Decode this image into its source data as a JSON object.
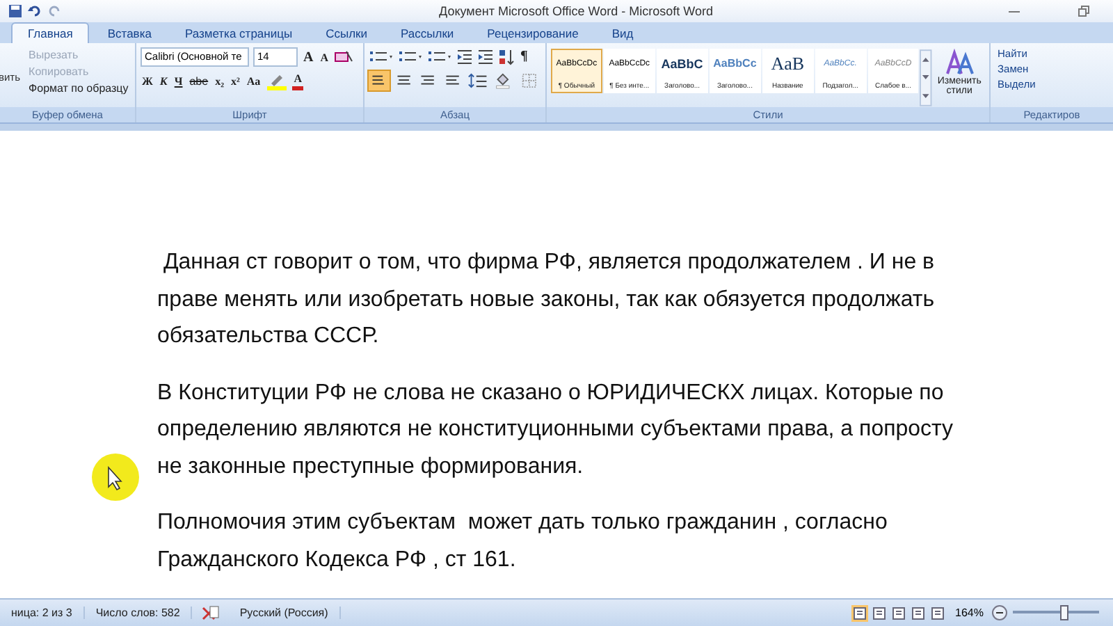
{
  "title_bar": {
    "title": "Документ Microsoft Office Word - Microsoft Word"
  },
  "tabs": [
    {
      "label": "Главная",
      "selected": true
    },
    {
      "label": "Вставка",
      "selected": false
    },
    {
      "label": "Разметка страницы",
      "selected": false
    },
    {
      "label": "Ссылки",
      "selected": false
    },
    {
      "label": "Рассылки",
      "selected": false
    },
    {
      "label": "Рецензирование",
      "selected": false
    },
    {
      "label": "Вид",
      "selected": false
    }
  ],
  "clipboard": {
    "paste_label": "вить",
    "items": [
      {
        "label": "Вырезать",
        "disabled": true
      },
      {
        "label": "Копировать",
        "disabled": true
      },
      {
        "label": "Формат по образцу",
        "disabled": false
      }
    ],
    "group_label": "Буфер обмена"
  },
  "font": {
    "family": "Calibri (Основной те",
    "size": "14",
    "grow": "A",
    "shrink": "A",
    "format_buttons": [
      "Ж",
      "К",
      "Ч",
      "abe",
      "x₂",
      "x²",
      "Aa"
    ],
    "color_letter": "A",
    "group_label": "Шрифт"
  },
  "paragraph": {
    "alignments": [
      {
        "selected": true
      },
      {
        "selected": false
      },
      {
        "selected": false
      },
      {
        "selected": false
      }
    ],
    "pilcrow": "¶",
    "group_label": "Абзац"
  },
  "styles": {
    "items": [
      {
        "sample": "AaBbCcDc",
        "label": "¶ Обычный",
        "kind": "normal",
        "selected": true
      },
      {
        "sample": "AaBbCcDc",
        "label": "¶ Без инте...",
        "kind": "normal",
        "selected": false
      },
      {
        "sample": "AaBbC",
        "label": "Заголово...",
        "kind": "heading1",
        "selected": false
      },
      {
        "sample": "AaBbCc",
        "label": "Заголово...",
        "kind": "heading2",
        "selected": false
      },
      {
        "sample": "AaB",
        "label": "Название",
        "kind": "title",
        "selected": false
      },
      {
        "sample": "AaBbCc.",
        "label": "Подзагол...",
        "kind": "subtitle",
        "selected": false
      },
      {
        "sample": "AaBbCcD",
        "label": "Слабое в...",
        "kind": "emphasis",
        "selected": false
      }
    ],
    "change_label": "Изменить стили",
    "group_label": "Стили"
  },
  "editing": {
    "items": [
      "Найти",
      "Замен",
      "Выдели"
    ],
    "group_label": "Редактиров"
  },
  "document": {
    "paragraphs": [
      {
        "lines": [
          " Данная ст говорит о том, что фирма РФ, является продолжателем . И не в",
          "праве менять или изобретать новые законы, так как обязуется продолжать",
          "обязательства СССР."
        ]
      },
      {
        "lines": [
          "В Конституции РФ не слова не сказано о ЮРИДИЧЕСКХ лицах. Которые по",
          "определению являются не конституционными субъектами права, а попросту",
          "не законные преступные формирования."
        ]
      },
      {
        "lines": [
          "Полномочия этим субъектам  может дать только гражданин , согласно",
          "Гражданского Кодекса РФ , ст 161."
        ]
      }
    ]
  },
  "status_bar": {
    "page": "ница: 2 из 3",
    "words": "Число слов: 582",
    "language": "Русский (Россия)",
    "zoom": "164%",
    "zoom_slider": {
      "level": 0.6
    }
  }
}
